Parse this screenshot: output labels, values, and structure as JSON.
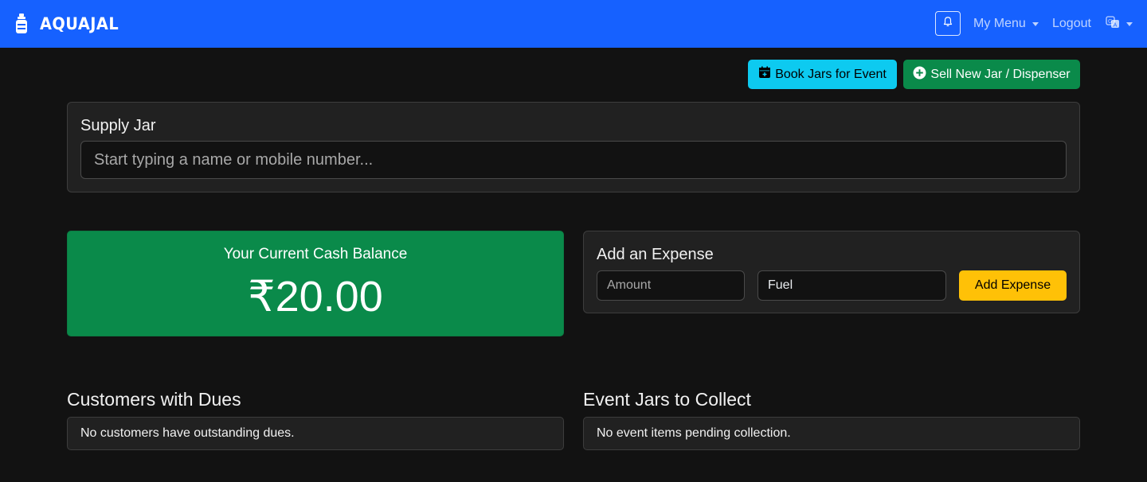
{
  "app": {
    "brand": "AQUAJAL"
  },
  "navbar": {
    "my_menu": "My Menu",
    "logout": "Logout"
  },
  "actions": {
    "book_jars": "Book Jars for Event",
    "sell_new": "Sell New Jar / Dispenser"
  },
  "supply": {
    "title": "Supply Jar",
    "placeholder": "Start typing a name or mobile number..."
  },
  "balance": {
    "label": "Your Current Cash Balance",
    "value": "₹20.00"
  },
  "expense": {
    "title": "Add an Expense",
    "amount_placeholder": "Amount",
    "category_value": "Fuel",
    "button": "Add Expense"
  },
  "dues": {
    "title": "Customers with Dues",
    "empty": "No customers have outstanding dues."
  },
  "event_jars": {
    "title": "Event Jars to Collect",
    "empty": "No event items pending collection."
  },
  "colors": {
    "navbar": "#1661ff",
    "background": "#121212",
    "card": "#212121",
    "success": "#0a8a4a",
    "info": "#0dcaf0",
    "warning": "#ffc107"
  }
}
